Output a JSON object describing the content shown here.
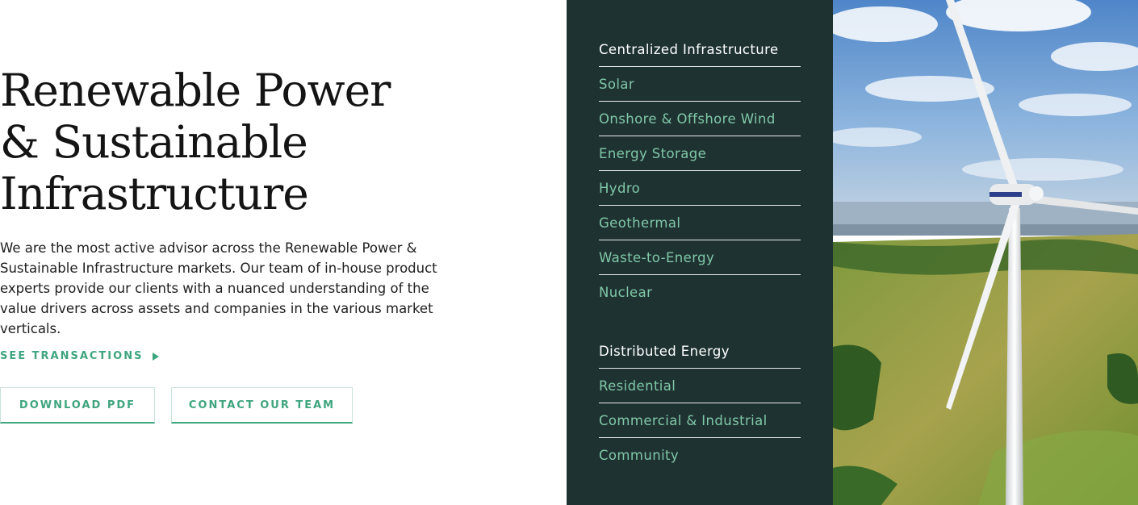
{
  "intro": {
    "headline": [
      "Renewable Power",
      "& Sustainable",
      "Infrastructure"
    ],
    "description": "We are the most active advisor across the Renewable Power & Sustainable Infrastructure markets. Our team of in-house product experts provide our clients with a nuanced understanding of the value drivers across assets and companies in the various market verticals.",
    "see_transactions": "SEE TRANSACTIONS",
    "buttons": {
      "download_pdf": "DOWNLOAD PDF",
      "contact_team": "CONTACT OUR TEAM"
    }
  },
  "menu": {
    "groups": [
      {
        "heading": "Centralized Infrastructure",
        "items": [
          "Solar",
          "Onshore & Offshore Wind",
          "Energy Storage",
          "Hydro",
          "Geothermal",
          "Waste-to-Energy",
          "Nuclear"
        ]
      },
      {
        "heading": "Distributed Energy",
        "items": [
          "Residential",
          "Commercial & Industrial",
          "Community"
        ]
      }
    ]
  },
  "colors": {
    "accent": "#3ea57e",
    "menu_bg": "#1f3232",
    "menu_link": "#7fc8a6"
  },
  "icons": {
    "see_transactions": "play-arrow-icon"
  }
}
